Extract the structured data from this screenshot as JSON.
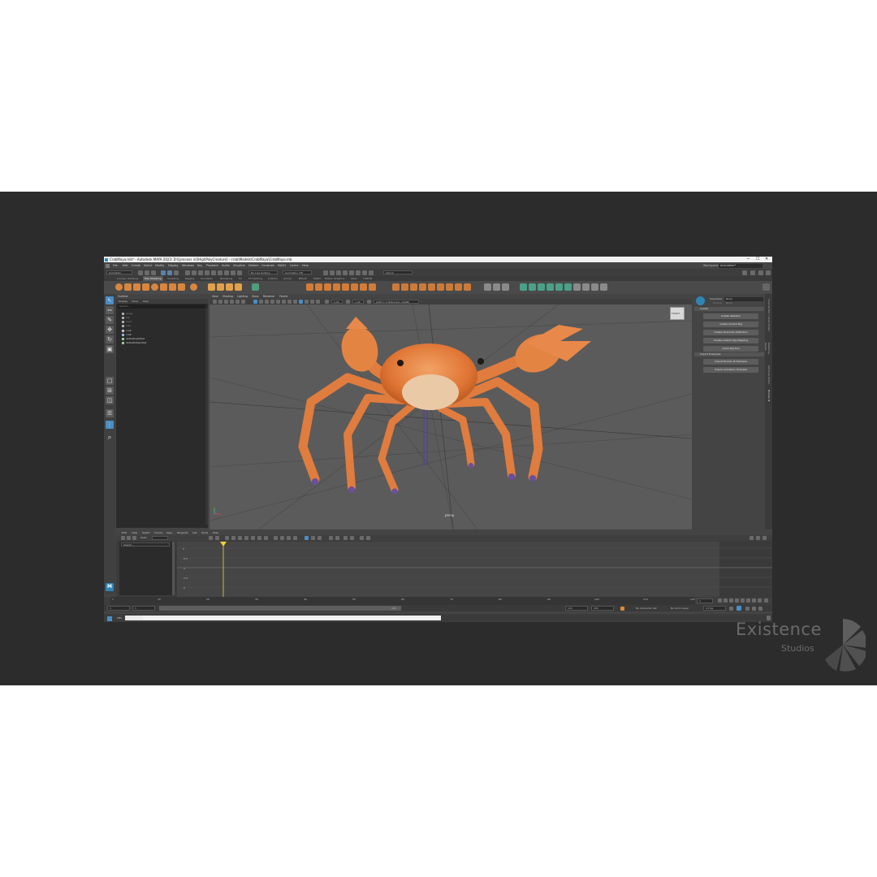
{
  "window": {
    "title": "CrabMaya.mb* - Autodesk MAYA 2023: D:\\[process in]\\HighPolyCreature] - crab\\Models\\CrabMaya\\CrabMaya.mb",
    "controls": [
      "─",
      "☐",
      "✕"
    ]
  },
  "menubar": [
    "File",
    "Edit",
    "Create",
    "Select",
    "Modify",
    "Display",
    "Windows",
    "Key",
    "Playback",
    "Audio",
    "Visualize",
    "Deform",
    "Constrain",
    "MASH",
    "Cache",
    "Help"
  ],
  "statusline": {
    "mode": "Animation",
    "no_live_surface": "No Live Surface",
    "symmetry": "Symmetry: Off",
    "sign_in": "Sign In",
    "workspace_label": "Workspace:",
    "workspace_value": "Animation*"
  },
  "shelf_tabs": [
    "Curves / Surfaces",
    "Poly Modeling",
    "Sculpting",
    "Rigging",
    "Animation",
    "Rendering",
    "FX",
    "FX Caching",
    "Custom",
    "Arnold",
    "Bifrost",
    "MASH",
    "Motion Graphics",
    "XGen",
    "TURTLE"
  ],
  "shelf_active": "Poly Modeling",
  "outliner": {
    "title": "Outliner",
    "menu": [
      "Display",
      "Show",
      "Help"
    ],
    "search": "Search...",
    "items": [
      "persp",
      "top",
      "front",
      "side",
      "crab",
      "crab",
      "defaultLightSet",
      "defaultObjectSet"
    ]
  },
  "viewport": {
    "menu": [
      "View",
      "Shading",
      "Lighting",
      "Show",
      "Renderer",
      "Panels"
    ],
    "exposure": "0.00",
    "gamma": "1.00",
    "colorspace": "ACES 1.0 SDR-video (sRGB)",
    "camera_label": "persp",
    "viewcube_label": "FRONT"
  },
  "right_panel": {
    "character_label": "Character:",
    "character_value": "None",
    "source_label": "Source:",
    "source_value": "None",
    "create_section": "Create",
    "buttons": [
      "Create Skeleton",
      "Create Control Rig",
      "Create Character Definition",
      "Create Custom Rig Mapping",
      "Quick Rig Tool"
    ],
    "import_section": "Import Examples",
    "import_buttons": [
      "Import Human IK Example",
      "Import Animation Example"
    ],
    "side_tabs": [
      "Channel Box / Layer Editor",
      "Modeling Toolkit",
      "Attribute Editor",
      "Human IK"
    ]
  },
  "graph_editor": {
    "menu": [
      "Edit",
      "View",
      "Select",
      "Curves",
      "Keys",
      "Tangents",
      "List",
      "Show",
      "Help"
    ],
    "stats": "Stats",
    "search": "Search...",
    "y_values": [
      "0",
      "-0.5",
      "-1",
      "-1.5",
      "-2"
    ]
  },
  "timeline": {
    "ticks": [
      "1",
      "10",
      "20",
      "30",
      "40",
      "50",
      "60",
      "70",
      "80",
      "90",
      "100",
      "110",
      "120"
    ],
    "current_frame": "1"
  },
  "range": {
    "start": "1",
    "start2": "1",
    "end": "120",
    "end2": "120",
    "max": "200",
    "character_set": "No Character Set",
    "anim_layer": "No Anim Layer",
    "fps": "24 fps"
  },
  "command": {
    "lang": "MEL",
    "mark": "// Result"
  },
  "watermark": {
    "title": "Existence",
    "subtitle": "Studios"
  },
  "colors": {
    "background": "#2c2c2c",
    "accent": "#e78a3a",
    "crab": "#e17a3c",
    "active_blue": "#4a8ec6",
    "playhead": "#f2d23c"
  }
}
